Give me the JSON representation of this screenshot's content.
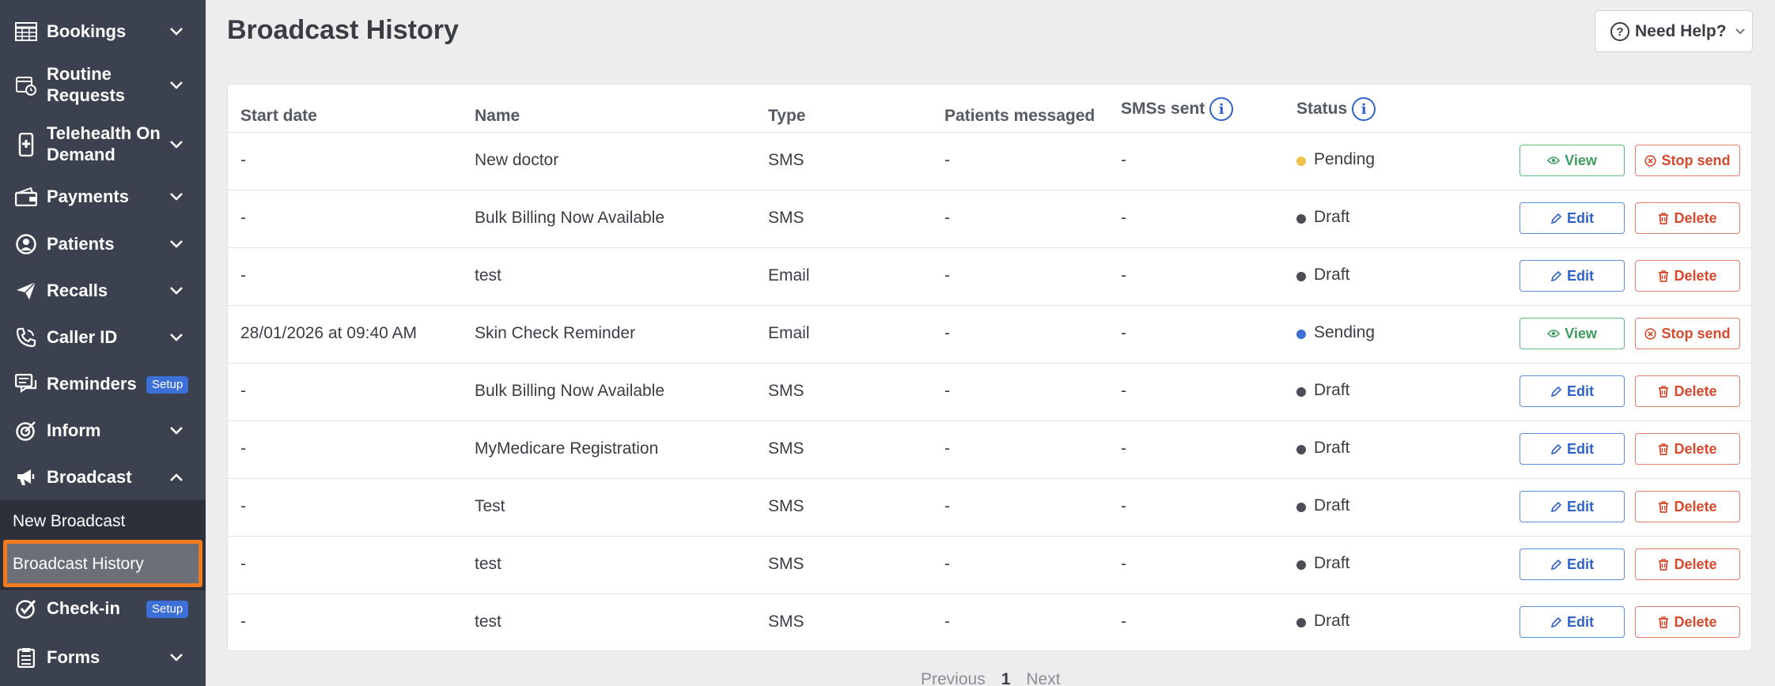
{
  "sidebar": {
    "items": [
      {
        "label": "Bookings"
      },
      {
        "label": "Routine\nRequests"
      },
      {
        "label": "Telehealth On\nDemand"
      },
      {
        "label": "Payments"
      },
      {
        "label": "Patients"
      },
      {
        "label": "Recalls"
      },
      {
        "label": "Caller ID"
      },
      {
        "label": "Reminders",
        "badge": "Setup"
      },
      {
        "label": "Inform"
      },
      {
        "label": "Broadcast"
      },
      {
        "label": "Check-in",
        "badge": "Setup"
      },
      {
        "label": "Forms"
      }
    ],
    "submenu": {
      "new_broadcast": "New Broadcast",
      "broadcast_history": "Broadcast History"
    }
  },
  "header": {
    "title": "Broadcast History",
    "help_label": "Need Help?",
    "help_icon": "?"
  },
  "table": {
    "columns": {
      "start_date": "Start date",
      "name": "Name",
      "type": "Type",
      "patients_messaged": "Patients messaged",
      "smss_sent": "SMSs sent",
      "status": "Status",
      "info_glyph": "i"
    },
    "rows": [
      {
        "start_date": "-",
        "name": "New doctor",
        "type": "SMS",
        "patients": "-",
        "sms": "-",
        "status": "Pending",
        "status_color": "#efc24a",
        "primary": "View",
        "secondary": "Stop send"
      },
      {
        "start_date": "-",
        "name": "Bulk Billing Now Available",
        "type": "SMS",
        "patients": "-",
        "sms": "-",
        "status": "Draft",
        "status_color": "#4a4d55",
        "primary": "Edit",
        "secondary": "Delete"
      },
      {
        "start_date": "-",
        "name": "test",
        "type": "Email",
        "patients": "-",
        "sms": "-",
        "status": "Draft",
        "status_color": "#4a4d55",
        "primary": "Edit",
        "secondary": "Delete"
      },
      {
        "start_date": "28/01/2026 at 09:40 AM",
        "name": "Skin Check Reminder",
        "type": "Email",
        "patients": "-",
        "sms": "-",
        "status": "Sending",
        "status_color": "#3d6fd8",
        "primary": "View",
        "secondary": "Stop send"
      },
      {
        "start_date": "-",
        "name": "Bulk Billing Now Available",
        "type": "SMS",
        "patients": "-",
        "sms": "-",
        "status": "Draft",
        "status_color": "#4a4d55",
        "primary": "Edit",
        "secondary": "Delete"
      },
      {
        "start_date": "-",
        "name": "MyMedicare Registration",
        "type": "SMS",
        "patients": "-",
        "sms": "-",
        "status": "Draft",
        "status_color": "#4a4d55",
        "primary": "Edit",
        "secondary": "Delete"
      },
      {
        "start_date": "-",
        "name": "Test",
        "type": "SMS",
        "patients": "-",
        "sms": "-",
        "status": "Draft",
        "status_color": "#4a4d55",
        "primary": "Edit",
        "secondary": "Delete"
      },
      {
        "start_date": "-",
        "name": "test",
        "type": "SMS",
        "patients": "-",
        "sms": "-",
        "status": "Draft",
        "status_color": "#4a4d55",
        "primary": "Edit",
        "secondary": "Delete"
      },
      {
        "start_date": "-",
        "name": "test",
        "type": "SMS",
        "patients": "-",
        "sms": "-",
        "status": "Draft",
        "status_color": "#4a4d55",
        "primary": "Edit",
        "secondary": "Delete"
      }
    ]
  },
  "pagination": {
    "previous": "Previous",
    "current": "1",
    "next": "Next"
  }
}
